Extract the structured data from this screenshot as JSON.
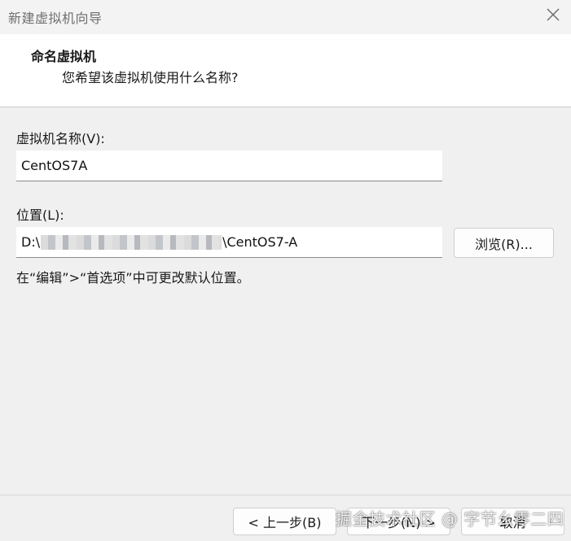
{
  "window": {
    "title": "新建虚拟机向导"
  },
  "header": {
    "title": "命名虚拟机",
    "subtitle": "您希望该虚拟机使用什么名称?"
  },
  "name_field": {
    "label": "虚拟机名称(V):",
    "value": "CentOS7A"
  },
  "location_field": {
    "label": "位置(L):",
    "value_prefix": "D:\\",
    "value_suffix": "\\CentOS7-A"
  },
  "buttons": {
    "browse": "浏览(R)...",
    "back": "< 上一步(B)",
    "next": "下一步(N) >",
    "cancel": "取消"
  },
  "hint": "在“编辑”>“首选项”中可更改默认位置。",
  "watermark": "掘金技术社区 @ 字节幺零二四",
  "icons": {
    "close": "close-icon"
  }
}
